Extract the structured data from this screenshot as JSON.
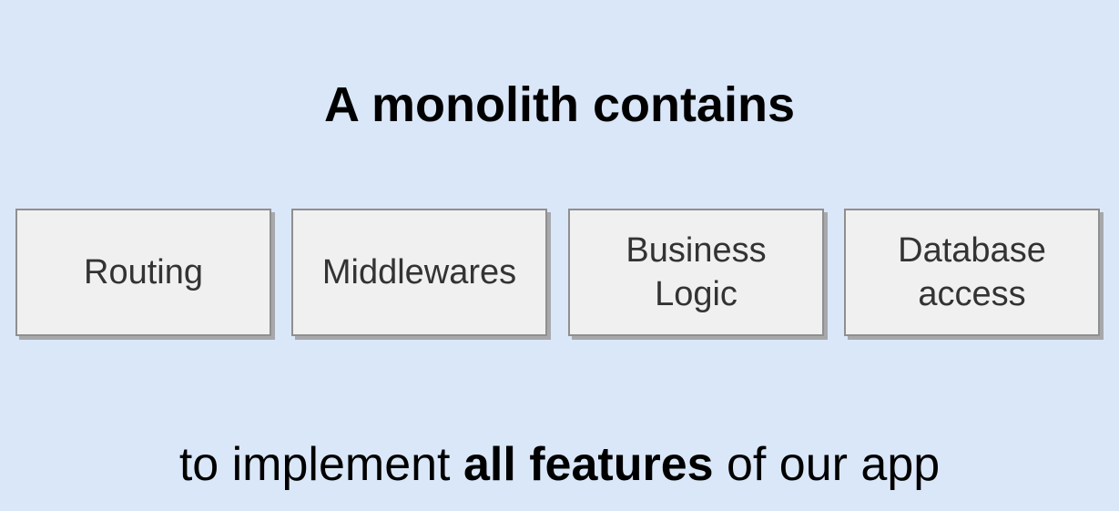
{
  "title": "A monolith contains",
  "boxes": [
    {
      "label": "Routing"
    },
    {
      "label": "Middlewares"
    },
    {
      "label": "Business Logic"
    },
    {
      "label": "Database access"
    }
  ],
  "caption": {
    "before": "to implement",
    "bold": "all features",
    "after": "of our app"
  },
  "colors": {
    "background": "#dae7f8",
    "box_fill": "#f0f0f0",
    "box_border": "#8f8f8f",
    "box_text": "#333333"
  }
}
